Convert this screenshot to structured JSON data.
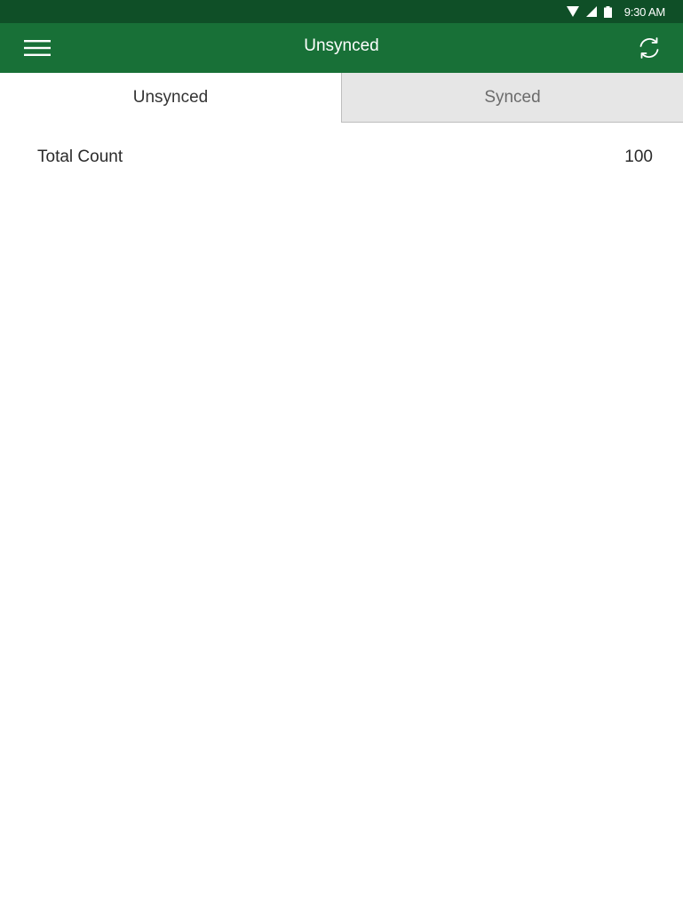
{
  "status_bar": {
    "time": "9:30 AM",
    "icons": [
      "wifi-icon",
      "signal-icon",
      "battery-icon"
    ],
    "background": "#0f4f27"
  },
  "app_bar": {
    "title": "Unsynced",
    "background": "#187037",
    "left_icon": "menu-icon",
    "right_icon": "refresh-icon"
  },
  "tabs": [
    {
      "label": "Unsynced",
      "active": true
    },
    {
      "label": "Synced",
      "active": false
    }
  ],
  "summary": {
    "label": "Total Count",
    "value": "100"
  }
}
